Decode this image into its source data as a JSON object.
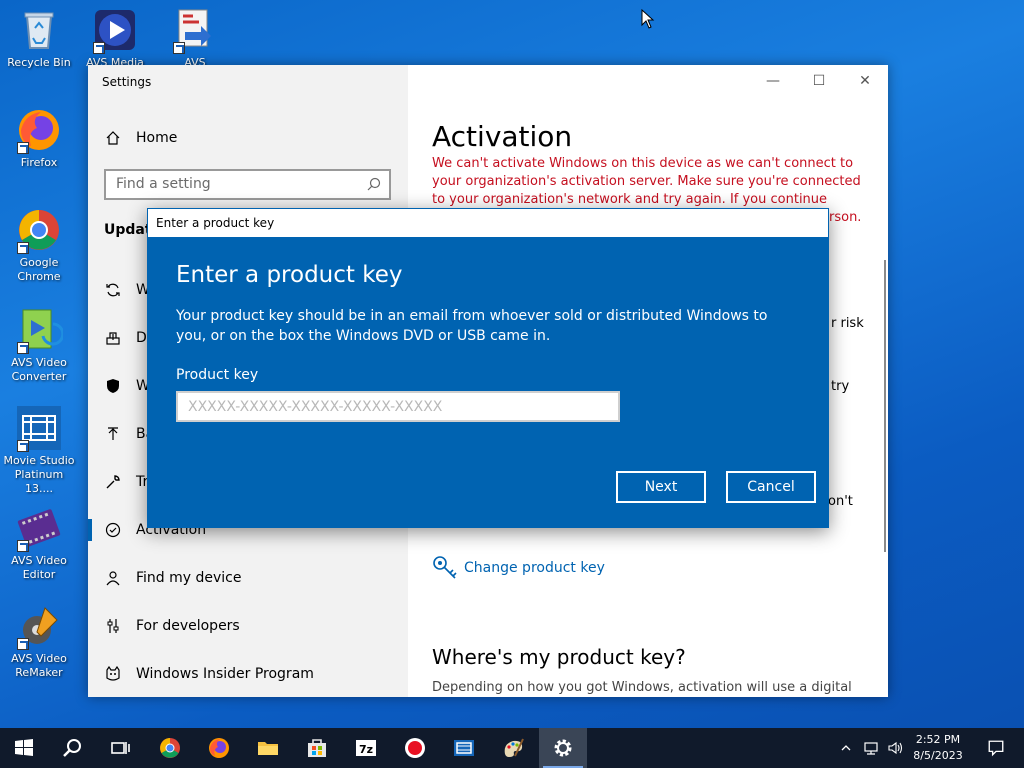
{
  "desktop": {
    "icons": [
      {
        "label": "Recycle Bin",
        "icon": "recycle-bin-icon"
      },
      {
        "label": "AVS Media",
        "icon": "avs-media-player-icon"
      },
      {
        "label": "AVS",
        "icon": "avs-icon"
      },
      {
        "label": "Firefox",
        "icon": "firefox-icon"
      },
      {
        "label": "Google Chrome",
        "icon": "chrome-icon"
      },
      {
        "label": "AVS Video Converter",
        "icon": "avs-video-converter-icon"
      },
      {
        "label": "Movie Studio Platinum 13....",
        "icon": "movie-studio-icon"
      },
      {
        "label": "AVS Video Editor",
        "icon": "avs-video-editor-icon"
      },
      {
        "label": "AVS Video ReMaker",
        "icon": "avs-video-remaker-icon"
      }
    ]
  },
  "settings": {
    "title": "Settings",
    "home_label": "Home",
    "search_placeholder": "Find a setting",
    "section_label": "Update",
    "nav_fragments": [
      "W",
      "De",
      "W",
      "Ba",
      "Tr"
    ],
    "nav_items": {
      "activation": "Activation",
      "find_device": "Find my device",
      "developers": "For developers",
      "insider": "Windows Insider Program"
    },
    "main": {
      "title": "Activation",
      "error": "We can't activate Windows on this device as we can't connect to your organization's activation server. Make sure you're connected to your organization's network and try again. If you continue having",
      "error_tail": "erson.",
      "fragments": [
        "r risk",
        "try",
        "on't"
      ],
      "change_key_link": "Change product key",
      "where_heading": "Where's my product key?",
      "where_text": "Depending on how you got Windows, activation will use a digital"
    }
  },
  "dialog": {
    "window_title": "Enter a product key",
    "heading": "Enter a product key",
    "description": "Your product key should be in an email from whoever sold or distributed Windows to you, or on the box the Windows DVD or USB came in.",
    "field_label": "Product key",
    "field_placeholder": "XXXXX-XXXXX-XXXXX-XXXXX-XXXXX",
    "field_value": "",
    "next_label": "Next",
    "cancel_label": "Cancel"
  },
  "taskbar": {
    "apps": [
      "start-icon",
      "search-icon",
      "task-view-icon",
      "chrome-icon",
      "firefox-icon",
      "file-explorer-icon",
      "store-icon",
      "7zip-icon",
      "recorder-icon",
      "video-editor-icon",
      "paint-icon",
      "settings-icon"
    ],
    "time": "2:52 PM",
    "date": "8/5/2023"
  }
}
